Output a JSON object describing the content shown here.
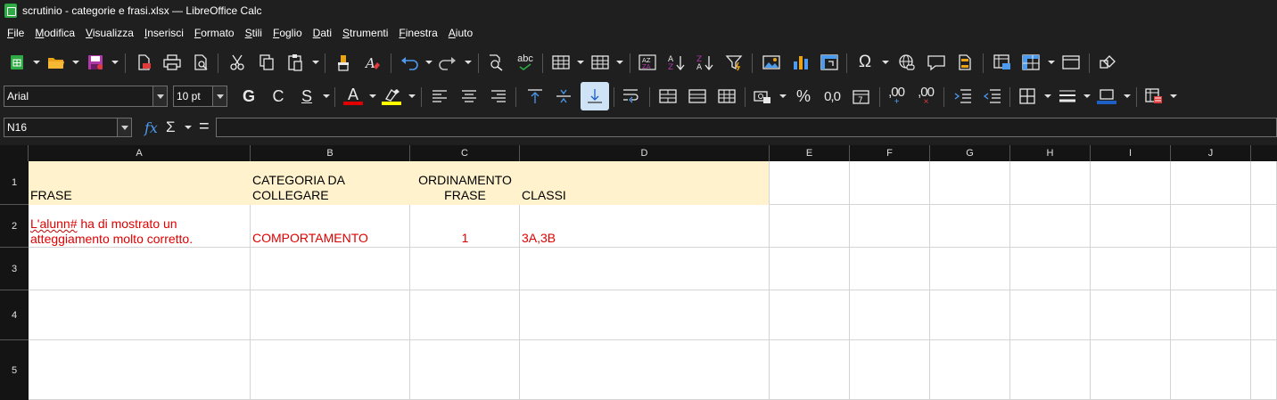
{
  "window": {
    "title": "scrutinio - categorie e frasi.xlsx — LibreOffice Calc"
  },
  "menu": [
    "File",
    "Modifica",
    "Visualizza",
    "Inserisci",
    "Formato",
    "Stili",
    "Foglio",
    "Dati",
    "Strumenti",
    "Finestra",
    "Aiuto"
  ],
  "formatting": {
    "font_name": "Arial",
    "font_size": "10 pt",
    "bold_glyph": "G",
    "italic_glyph": "C",
    "underline_glyph": "S",
    "font_color_glyph": "A",
    "percent_glyph": "%",
    "decimal_glyph": "0,0",
    "add_decimal_glyph": ",00",
    "del_decimal_glyph": ",00",
    "font_color": "#e00000",
    "highlight_color": "#ffff00",
    "border_color": "#1e5fc4"
  },
  "toolbar_glyphs": {
    "spelling": "abc",
    "special_char": "Ω",
    "formula_fx": "fx",
    "sigma": "Σ",
    "equal": "="
  },
  "formula_bar": {
    "cell_ref": "N16",
    "content": ""
  },
  "columns": [
    "A",
    "B",
    "C",
    "D",
    "E",
    "F",
    "G",
    "H",
    "I",
    "J"
  ],
  "rows": [
    "1",
    "2",
    "3",
    "4",
    "5"
  ],
  "cells": {
    "A1": "FRASE",
    "B1": "CATEGORIA DA\nCOLLEGARE",
    "C1": "ORDINAMENTO\nFRASE",
    "D1": "CLASSI",
    "A2_word": "L'alunn#",
    "A2_rest": " ha di mostrato un\natteggiamento molto corretto.",
    "B2": "COMPORTAMENTO",
    "C2": "1",
    "D2": "3A,3B"
  },
  "colors": {
    "header_fill": "#fff2cc",
    "row2_text": "#e00000",
    "ui_background": "#1f1f1f",
    "grid_lines": "#d4d4d4"
  }
}
